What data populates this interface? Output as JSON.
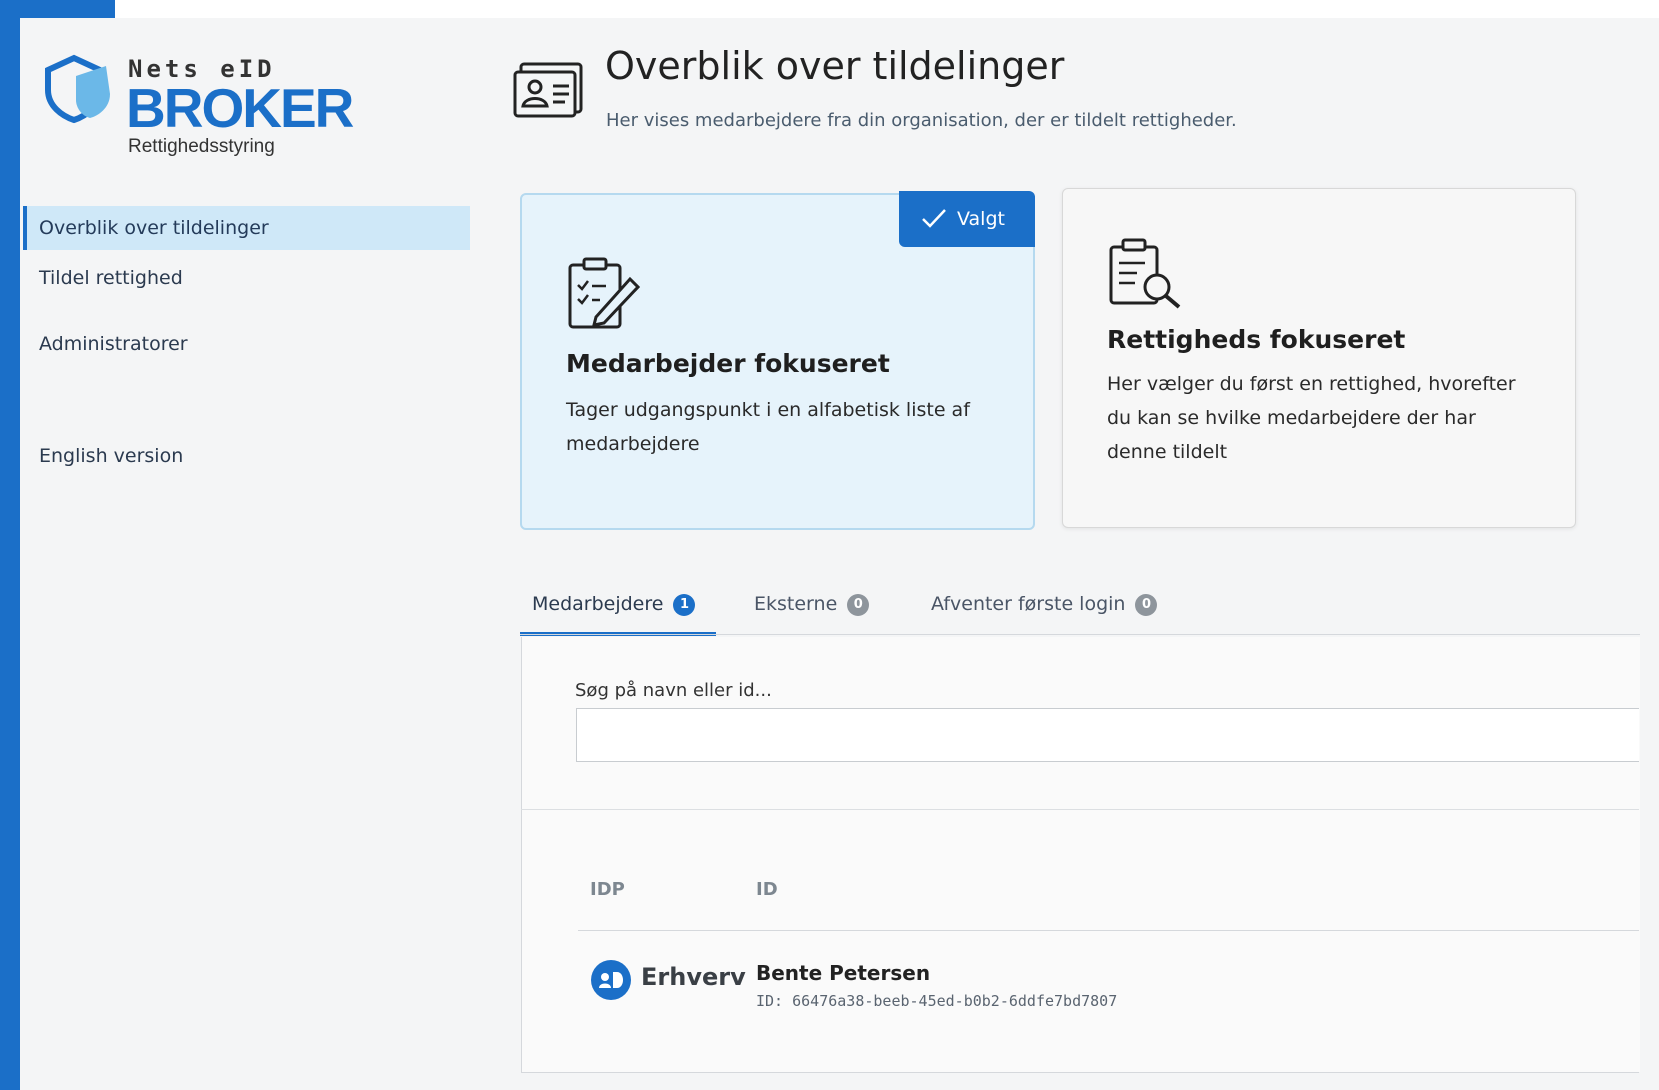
{
  "brand": {
    "top": "Nets eID",
    "name": "BROKER",
    "sub": "Rettighedsstyring",
    "color": "#1b6fc8"
  },
  "sidebar": {
    "items": [
      {
        "label": "Overblik over tildelinger",
        "active": true
      },
      {
        "label": "Tildel rettighed",
        "active": false
      },
      {
        "label": "Administratorer",
        "active": false
      },
      {
        "label": "English version",
        "active": false
      }
    ]
  },
  "header": {
    "icon": "id-card-icon",
    "title": "Overblik over tildelinger",
    "subtitle": "Her vises medarbejdere fra din organisation, der er tildelt rettigheder."
  },
  "cards": [
    {
      "icon": "clipboard-edit-icon",
      "title": "Medarbejder fokuseret",
      "description": "Tager udgangspunkt i en alfabetisk liste af medarbejdere",
      "selected": true,
      "badge": "Valgt"
    },
    {
      "icon": "clipboard-search-icon",
      "title": "Rettigheds fokuseret",
      "description": "Her vælger du først en rettighed, hvorefter du kan se hvilke medarbejdere der har denne tildelt",
      "selected": false
    }
  ],
  "tabs": [
    {
      "label": "Medarbejdere",
      "count": "1",
      "active": true
    },
    {
      "label": "Eksterne",
      "count": "0",
      "active": false
    },
    {
      "label": "Afventer første login",
      "count": "0",
      "active": false
    }
  ],
  "search": {
    "label": "Søg på navn eller id...",
    "value": "",
    "placeholder": ""
  },
  "table": {
    "columns": [
      "IDP",
      "ID"
    ],
    "rows": [
      {
        "idp_icon": "id-badge-icon",
        "idp": "Erhverv",
        "name": "Bente Petersen",
        "id": "ID: 66476a38-beeb-45ed-b0b2-6ddfe7bd7807"
      }
    ]
  }
}
